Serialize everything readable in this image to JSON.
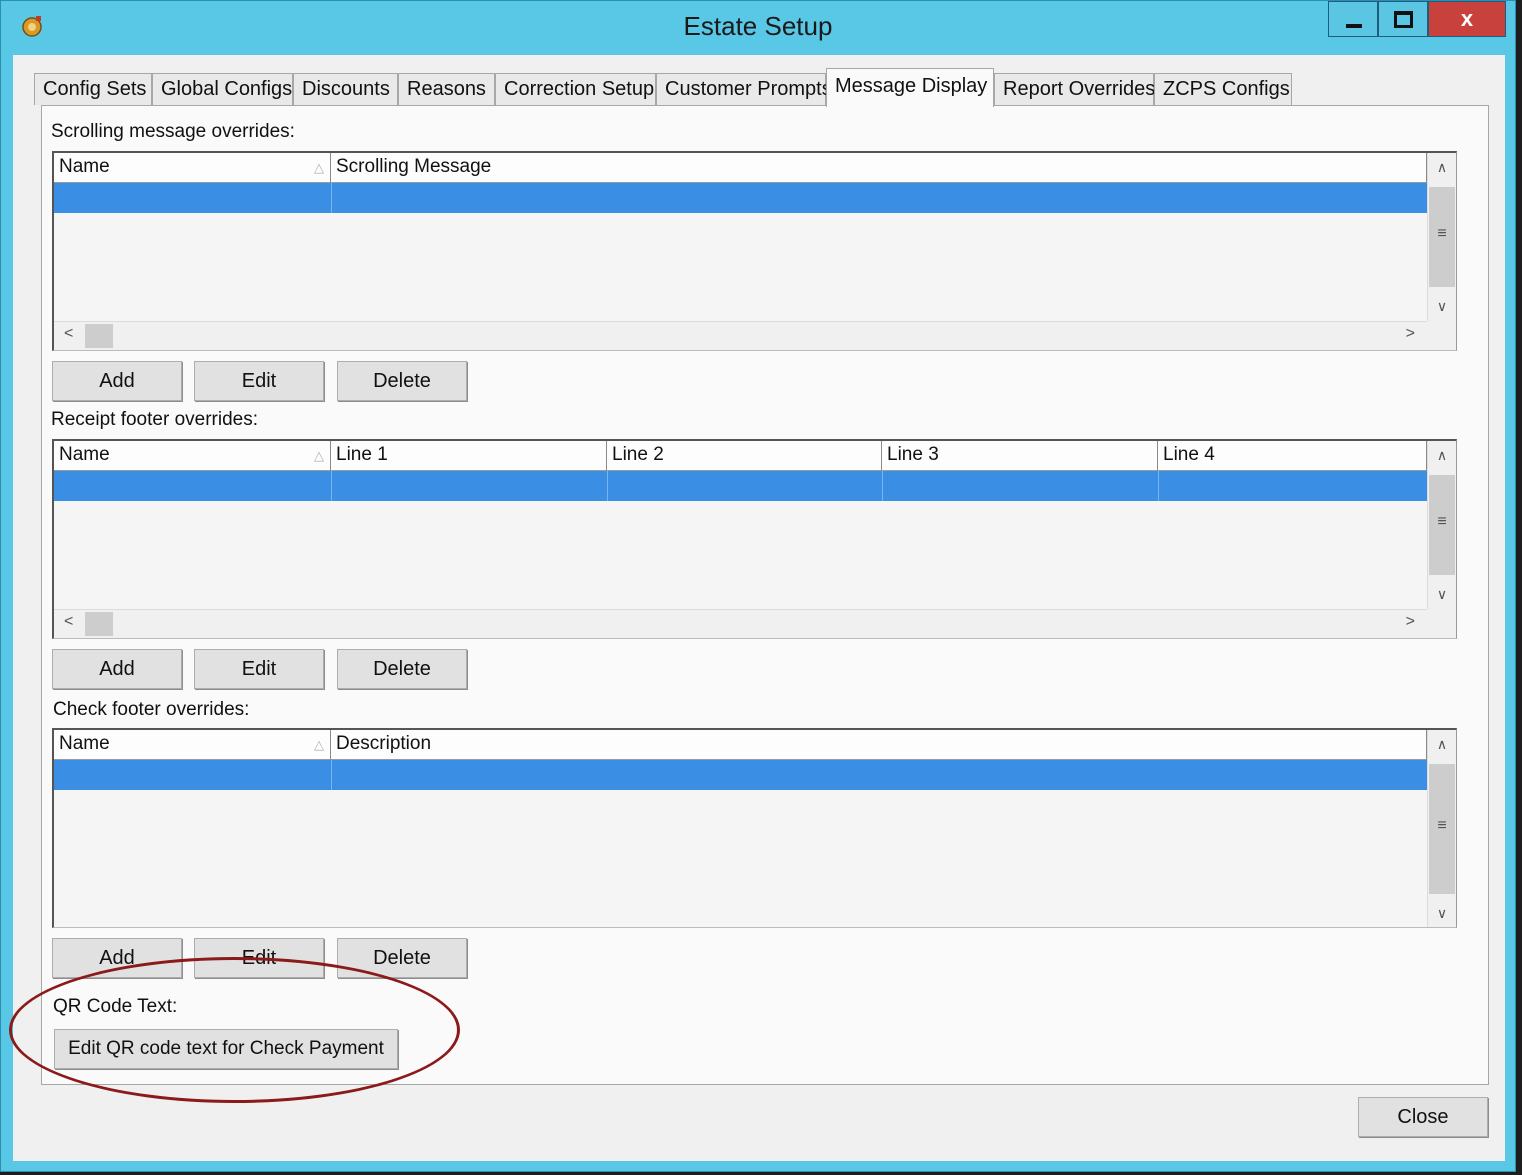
{
  "window": {
    "title": "Estate Setup",
    "close_glyph": "x"
  },
  "tabs": [
    {
      "label": "Config Sets"
    },
    {
      "label": "Global Configs"
    },
    {
      "label": "Discounts"
    },
    {
      "label": "Reasons"
    },
    {
      "label": "Correction Setup"
    },
    {
      "label": "Customer Prompts"
    },
    {
      "label": "Message Display",
      "active": true
    },
    {
      "label": "Report Overrides"
    },
    {
      "label": "ZCPS Configs"
    }
  ],
  "scrolling": {
    "label": "Scrolling message overrides:",
    "columns": [
      "Name",
      "Scrolling Message"
    ],
    "buttons": {
      "add": "Add",
      "edit": "Edit",
      "delete": "Delete"
    }
  },
  "receipt": {
    "label": "Receipt footer overrides:",
    "columns": [
      "Name",
      "Line 1",
      "Line 2",
      "Line 3",
      "Line 4"
    ],
    "buttons": {
      "add": "Add",
      "edit": "Edit",
      "delete": "Delete"
    }
  },
  "check": {
    "label": "Check footer overrides:",
    "columns": [
      "Name",
      "Description"
    ],
    "buttons": {
      "add": "Add",
      "edit": "Edit",
      "delete": "Delete"
    }
  },
  "qr": {
    "label": "QR Code Text:",
    "button": "Edit QR code text for Check Payment"
  },
  "footer": {
    "close": "Close"
  },
  "icons": {
    "sort": "△",
    "up": "∧",
    "down": "∨",
    "left": "<",
    "right": ">",
    "grip": "≡"
  },
  "colors": {
    "titlebar": "#59c7e6",
    "close_button": "#c9413c",
    "selection": "#3a8fe4",
    "annotation": "#8b1a1a"
  }
}
